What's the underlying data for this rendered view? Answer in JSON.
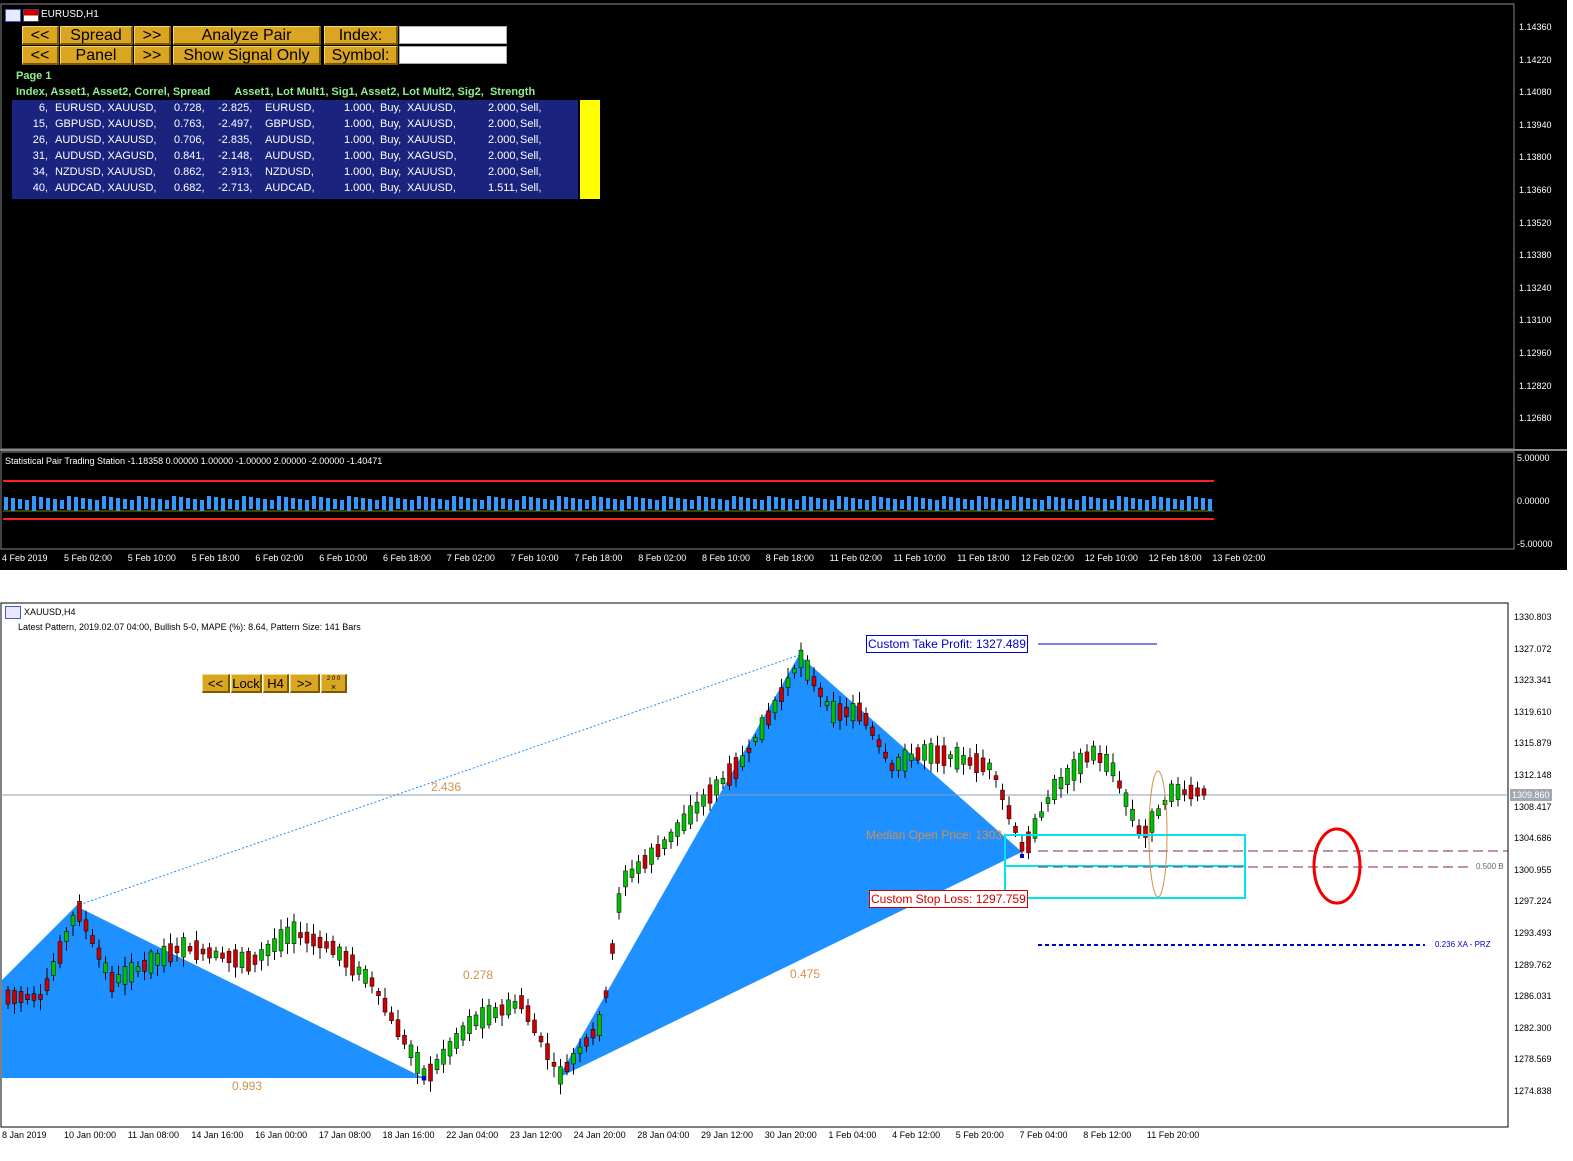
{
  "top_window": {
    "title": "EURUSD,H1",
    "buttons": {
      "prev1": "<<",
      "spread": "Spread",
      "next1": ">>",
      "analyze": "Analyze Pair",
      "index_label": "Index:",
      "prev2": "<<",
      "panel": "Panel",
      "next2": ">>",
      "show_signal": "Show Signal Only",
      "symbol_label": "Symbol:"
    },
    "index_value": "",
    "symbol_value": "",
    "page_label": "Page 1",
    "table_header": "Index, Asset1, Asset2, Correl, Spread        Asset1, Lot Mult1, Sig1, Asset2, Lot Mult2, Sig2,  Strength",
    "rows": [
      {
        "index": "6,",
        "pair": "EURUSD, XAUUSD,",
        "correl": "0.728,",
        "spread": "-2.825,",
        "asset1": "EURUSD,",
        "lot1": "1.000,",
        "sig1": "Buy,",
        "asset2": "XAUUSD,",
        "lot2": "2.000,",
        "sig2": "Sell,"
      },
      {
        "index": "15,",
        "pair": "GBPUSD, XAUUSD,",
        "correl": "0.763,",
        "spread": "-2.497,",
        "asset1": "GBPUSD,",
        "lot1": "1.000,",
        "sig1": "Buy,",
        "asset2": "XAUUSD,",
        "lot2": "2.000,",
        "sig2": "Sell,"
      },
      {
        "index": "26,",
        "pair": "AUDUSD, XAUUSD,",
        "correl": "0.706,",
        "spread": "-2.835,",
        "asset1": "AUDUSD,",
        "lot1": "1.000,",
        "sig1": "Buy,",
        "asset2": "XAUUSD,",
        "lot2": "2.000,",
        "sig2": "Sell,"
      },
      {
        "index": "31,",
        "pair": "AUDUSD, XAGUSD,",
        "correl": "0.841,",
        "spread": "-2.148,",
        "asset1": "AUDUSD,",
        "lot1": "1.000,",
        "sig1": "Buy,",
        "asset2": "XAGUSD,",
        "lot2": "2.000,",
        "sig2": "Sell,"
      },
      {
        "index": "34,",
        "pair": "NZDUSD, XAUUSD,",
        "correl": "0.862,",
        "spread": "-2.913,",
        "asset1": "NZDUSD,",
        "lot1": "1.000,",
        "sig1": "Buy,",
        "asset2": "XAUUSD,",
        "lot2": "2.000,",
        "sig2": "Sell,"
      },
      {
        "index": "40,",
        "pair": "AUDCAD, XAUUSD,",
        "correl": "0.682,",
        "spread": "-2.713,",
        "asset1": "AUDCAD,",
        "lot1": "1.000,",
        "sig1": "Buy,",
        "asset2": "XAUUSD,",
        "lot2": "1.511,",
        "sig2": "Sell,"
      }
    ],
    "price_axis": [
      "1.14360",
      "1.14220",
      "1.14080",
      "1.13940",
      "1.13800",
      "1.13660",
      "1.13520",
      "1.13380",
      "1.13240",
      "1.13100",
      "1.12960",
      "1.12820",
      "1.12680"
    ],
    "indicator_label": "Statistical Pair Trading Station -1.18358 0.00000 1.00000 -1.00000 2.00000 -2.00000 -1.40471",
    "indicator_axis": [
      "5.00000",
      "0.00000",
      "-5.00000"
    ],
    "time_axis": [
      "4 Feb 2019",
      "5 Feb 02:00",
      "5 Feb 10:00",
      "5 Feb 18:00",
      "6 Feb 02:00",
      "6 Feb 10:00",
      "6 Feb 18:00",
      "7 Feb 02:00",
      "7 Feb 10:00",
      "7 Feb 18:00",
      "8 Feb 02:00",
      "8 Feb 10:00",
      "8 Feb 18:00",
      "11 Feb 02:00",
      "11 Feb 10:00",
      "11 Feb 18:00",
      "12 Feb 02:00",
      "12 Feb 10:00",
      "12 Feb 18:00",
      "13 Feb 02:00"
    ]
  },
  "bottom_window": {
    "title": "XAUUSD,H4",
    "info": "Latest Pattern, 2019.02.07 04:00, Bullish 5-0, MAPE (%): 8.64, Pattern Size: 141 Bars",
    "panel_buttons": {
      "prev": "<<",
      "lock": "Lock",
      "tf": "H4",
      "next": ">>",
      "extra": "2 0 0"
    },
    "ratios": {
      "r1": "2.436",
      "r2": "0.278",
      "r3": "0.993",
      "r4": "0.475"
    },
    "take_profit": "Custom Take Profit: 1327.489",
    "stop_loss": "Custom Stop Loss: 1297.759",
    "median_open": "Median Open Price: 1303",
    "prz_label": "0.236 XA - PRZ",
    "level_label": "0.500 B",
    "current_price": "1309.860",
    "price_axis": [
      "1330.803",
      "1327.072",
      "1323.341",
      "1319.610",
      "1315.879",
      "1312.148",
      "1308.417",
      "1304.686",
      "1300.955",
      "1297.224",
      "1293.493",
      "1289.762",
      "1286.031",
      "1282.300",
      "1278.569",
      "1274.838"
    ],
    "time_axis": [
      "8 Jan 2019",
      "10 Jan 00:00",
      "11 Jan 08:00",
      "14 Jan 16:00",
      "16 Jan 00:00",
      "17 Jan 08:00",
      "18 Jan 16:00",
      "22 Jan 04:00",
      "23 Jan 12:00",
      "24 Jan 20:00",
      "28 Jan 04:00",
      "29 Jan 12:00",
      "30 Jan 20:00",
      "1 Feb 04:00",
      "4 Feb 12:00",
      "5 Feb 20:00",
      "7 Feb 04:00",
      "8 Feb 12:00",
      "11 Feb 20:00"
    ]
  },
  "colors": {
    "button": "#DAA520",
    "pattern": "#1E90FF",
    "bull": "#00C000",
    "bear": "#CC0000",
    "table_bg": "#1A237E",
    "strength": "#FFFF00",
    "ratio": "#D2914B",
    "header_green": "#90EE90"
  }
}
